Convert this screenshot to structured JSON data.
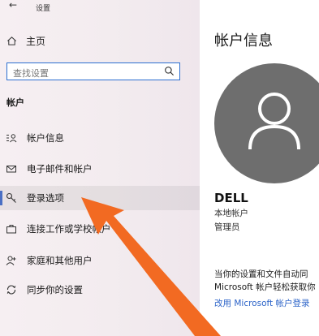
{
  "window": {
    "title": "设置",
    "back_glyph": "←"
  },
  "sidebar": {
    "home_label": "主页",
    "search_placeholder": "查找设置",
    "section_header": "帐户",
    "items": [
      {
        "label": "帐户信息",
        "icon": "person-card-icon",
        "selected": false
      },
      {
        "label": "电子邮件和帐户",
        "icon": "mail-icon",
        "selected": false
      },
      {
        "label": "登录选项",
        "icon": "key-icon",
        "selected": true
      },
      {
        "label": "连接工作或学校帐户",
        "icon": "briefcase-icon",
        "selected": false
      },
      {
        "label": "家庭和其他用户",
        "icon": "person-add-icon",
        "selected": false
      },
      {
        "label": "同步你的设置",
        "icon": "sync-icon",
        "selected": false
      }
    ]
  },
  "main": {
    "title": "帐户信息",
    "user_name": "DELL",
    "account_type": "本地帐户",
    "account_role": "管理员",
    "description_line1": "当你的设置和文件自动同",
    "description_line2": "Microsoft 帐户轻松获取你",
    "link_label": "改用 Microsoft 帐户登录"
  },
  "colors": {
    "accent": "#2c6fd1",
    "link": "#2b63c8",
    "selected_indicator": "#4a6fc4",
    "avatar_bg": "#6e6e6e",
    "annotation_arrow": "#f26a22"
  }
}
